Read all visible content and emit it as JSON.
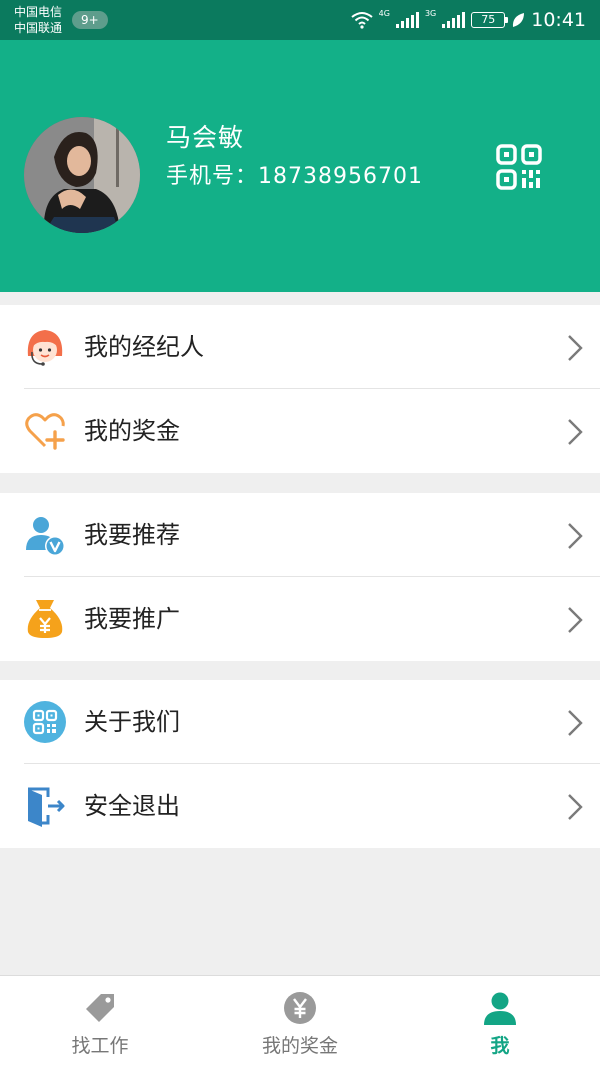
{
  "status_bar": {
    "carrier_1": "中国电信",
    "carrier_2": "中国联通",
    "notification_badge": "9+",
    "network_1": "4G",
    "network_2": "3G",
    "battery": "75",
    "time": "10:41"
  },
  "profile": {
    "name": "马会敏",
    "phone_label": "手机号：",
    "phone": "18738956701"
  },
  "menu": {
    "agent": "我的经纪人",
    "bonus": "我的奖金",
    "recommend": "我要推荐",
    "promote": "我要推广",
    "about": "关于我们",
    "logout": "安全退出"
  },
  "tabs": {
    "find_job": "找工作",
    "my_bonus": "我的奖金",
    "me": "我"
  },
  "colors": {
    "primary": "#13b088",
    "status_bar": "#0b7a5e",
    "active_tab": "#13a585",
    "inactive_tab": "#999999"
  }
}
